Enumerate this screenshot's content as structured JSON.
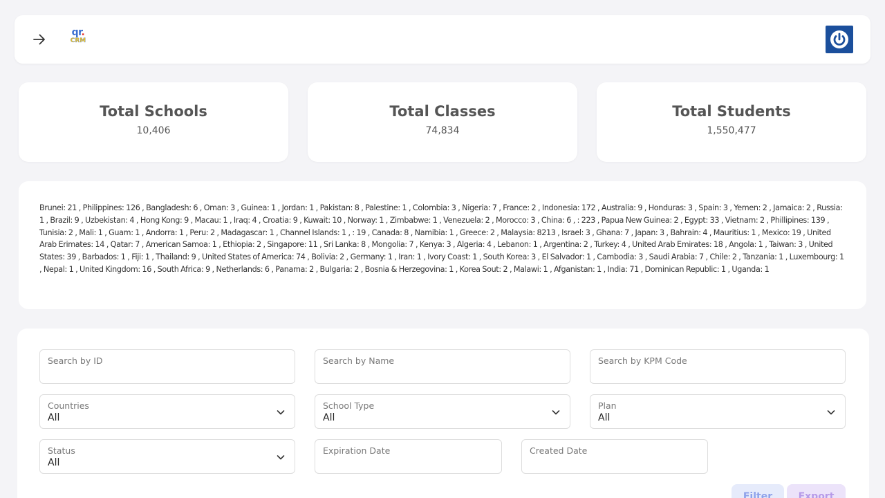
{
  "header": {
    "back_icon": "arrow-right-icon",
    "logo_top": "qr",
    "logo_dot": ".",
    "logo_bottom": "CRM",
    "power_icon": "power-icon",
    "power_color": "#1b4f9c"
  },
  "stats": [
    {
      "title": "Total Schools",
      "value": "10,406"
    },
    {
      "title": "Total Classes",
      "value": "74,834"
    },
    {
      "title": "Total Students",
      "value": "1,550,477"
    }
  ],
  "countries_text": "Brunei: 21 , Philippines: 126 , Bangladesh: 6 , Oman: 3 , Guinea: 1 , Jordan: 1 , Pakistan: 8 , Palestine: 1 , Colombia: 3 , Nigeria: 7 , France: 2 , Indonesia: 172 , Australia: 9 , Honduras: 3 , Spain: 3 , Yemen: 2 , Jamaica: 2 , Russia: 1 , Brazil: 9 , Uzbekistan: 4 , Hong Kong: 9 , Macau: 1 , Iraq: 4 , Croatia: 9 , Kuwait: 10 , Norway: 1 , Zimbabwe: 1 , Venezuela: 2 , Morocco: 3 , China: 6 , : 223 , Papua New Guinea: 2 , Egypt: 33 , Vietnam: 2 , Phillipines: 139 , Tunisia: 2 , Mali: 1 , Guam: 1 , Andorra: 1 , Peru: 2 , Madagascar: 1 , Channel Islands: 1 , : 19 , Canada: 8 , Namibia: 1 , Greece: 2 , Malaysia: 8213 , Israel: 3 , Ghana: 7 , Japan: 3 , Bahrain: 4 , Mauritius: 1 , Mexico: 19 , United Arab Erimates: 14 , Qatar: 7 , American Samoa: 1 , Ethiopia: 2 , Singapore: 11 , Sri Lanka: 8 , Mongolia: 7 , Kenya: 3 , Algeria: 4 , Lebanon: 1 , Argentina: 2 , Turkey: 4 , United Arab Emirates: 18 , Angola: 1 , Taiwan: 3 , United States: 39 , Barbados: 1 , Fiji: 1 , Thailand: 9 , United States of America: 74 , Bolivia: 2 , Germany: 1 , Iran: 1 , Ivory Coast: 1 , South Korea: 3 , El Salvador: 1 , Cambodia: 3 , Saudi Arabia: 7 , Chile: 2 , Tanzania: 1 , Luxembourg: 1 , Nepal: 1 , United Kingdom: 16 , South Africa: 9 , Netherlands: 6 , Panama: 2 , Bulgaria: 2 , Bosnia & Herzegovina: 1 , Korea Sout: 2 , Malawi: 1 , Afganistan: 1 , India: 71 , Dominican Republic: 1 , Uganda: 1",
  "filters": {
    "search_id": {
      "label": "Search by ID",
      "value": ""
    },
    "search_name": {
      "label": "Search by Name",
      "value": ""
    },
    "search_kpm": {
      "label": "Search by KPM Code",
      "value": ""
    },
    "countries": {
      "label": "Countries",
      "value": "All"
    },
    "school_type": {
      "label": "School Type",
      "value": "All"
    },
    "plan": {
      "label": "Plan",
      "value": "All"
    },
    "status": {
      "label": "Status",
      "value": "All"
    },
    "expiration_date": {
      "label": "Expiration Date",
      "value": ""
    },
    "created_date": {
      "label": "Created Date",
      "value": ""
    }
  },
  "buttons": {
    "filter_label": "Filter",
    "export_label": "Export"
  }
}
